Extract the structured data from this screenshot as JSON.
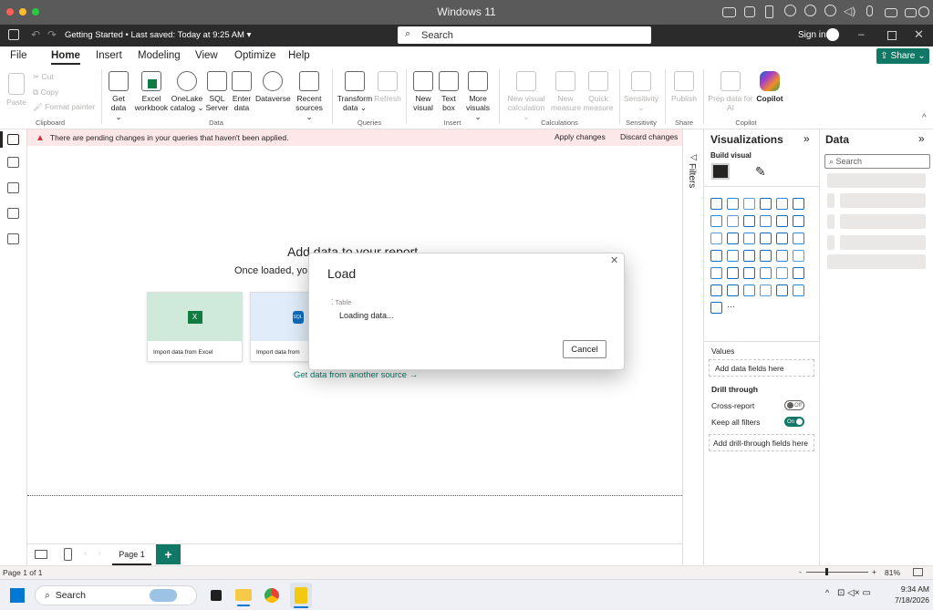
{
  "mac": {
    "window_title": "Windows 11"
  },
  "titlebar": {
    "file_title": "Getting Started",
    "saved_status": "• Last saved: Today at 9:25 AM",
    "search_placeholder": "Search",
    "sign_in": "Sign in"
  },
  "menu": {
    "tabs": [
      "File",
      "Home",
      "Insert",
      "Modeling",
      "View",
      "Optimize",
      "Help"
    ],
    "share": "Share"
  },
  "ribbon": {
    "clipboard": {
      "paste": "Paste",
      "cut": "Cut",
      "copy": "Copy",
      "format_painter": "Format painter",
      "group": "Clipboard"
    },
    "data": {
      "get_data": [
        "Get",
        "data ⌄"
      ],
      "excel": [
        "Excel",
        "workbook"
      ],
      "onelake": [
        "OneLake",
        "catalog ⌄"
      ],
      "sql": [
        "SQL",
        "Server"
      ],
      "enter": [
        "Enter",
        "data"
      ],
      "dataverse": [
        "Dataverse",
        ""
      ],
      "recent": [
        "Recent",
        "sources ⌄"
      ],
      "group": "Data"
    },
    "queries": {
      "transform": [
        "Transform",
        "data ⌄"
      ],
      "refresh": "Refresh",
      "group": "Queries"
    },
    "insert": {
      "new_visual": [
        "New",
        "visual"
      ],
      "text_box": [
        "Text",
        "box"
      ],
      "more_visuals": [
        "More",
        "visuals ⌄"
      ],
      "group": "Insert"
    },
    "calculations": {
      "new_visual_calc": [
        "New visual",
        "calculation ⌄"
      ],
      "new_measure": [
        "New",
        "measure"
      ],
      "quick_measure": [
        "Quick",
        "measure"
      ],
      "group": "Calculations"
    },
    "sensitivity": {
      "label": [
        "Sensitivity",
        "⌄"
      ],
      "group": "Sensitivity"
    },
    "share": {
      "publish": "Publish",
      "group": "Share"
    },
    "copilot": {
      "prep": [
        "Prep data for",
        "AI"
      ],
      "copilot": "Copilot",
      "group": "Copilot"
    }
  },
  "warning": {
    "text": "There are pending changes in your queries that haven't been applied.",
    "apply": "Apply changes",
    "discard": "Discard changes"
  },
  "canvas": {
    "heading": "Add data to your report",
    "subheading": "Once loaded, yo",
    "card_excel": "Import data from Excel",
    "card_sql": "Import data from",
    "another_source": "Get data from another source →"
  },
  "modal": {
    "title": "Load",
    "table_label": "Table",
    "status": "Loading data...",
    "cancel": "Cancel"
  },
  "filters": {
    "label": "Filters"
  },
  "visualizations": {
    "title": "Visualizations",
    "build_visual": "Build visual",
    "values": "Values",
    "add_fields": "Add data fields here",
    "drill_through": "Drill through",
    "cross_report": "Cross-report",
    "cross_report_state": "Off",
    "keep_filters": "Keep all filters",
    "keep_filters_state": "On",
    "add_drill": "Add drill-through fields here"
  },
  "data_pane": {
    "title": "Data",
    "search_placeholder": "Search"
  },
  "pages": {
    "tabs": [
      "Page 1"
    ]
  },
  "status": {
    "page": "Page 1 of 1",
    "zoom": "81%"
  },
  "taskbar": {
    "search": "Search",
    "time": "9:34 AM",
    "date": "7/18/2026"
  }
}
